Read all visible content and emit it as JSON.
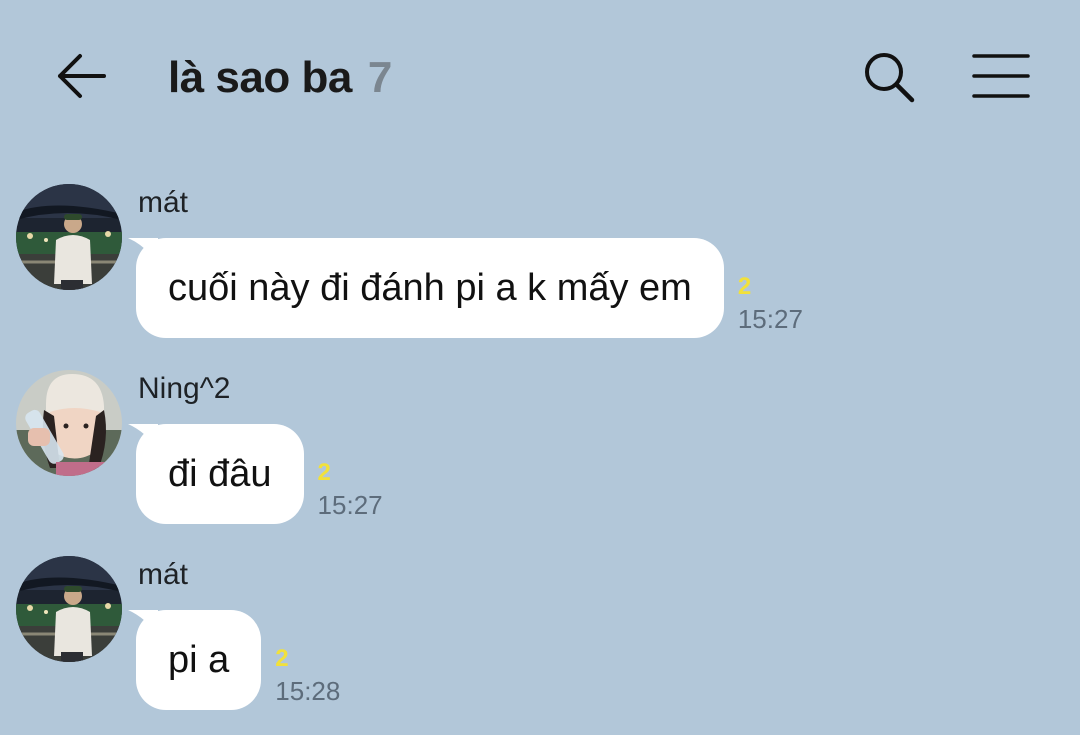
{
  "header": {
    "title": "là sao ba",
    "member_count": "7",
    "back_icon": "back-arrow-icon",
    "search_icon": "search-icon",
    "menu_icon": "hamburger-menu-icon"
  },
  "colors": {
    "background": "#b2c7d9",
    "bubble": "#ffffff",
    "unread": "#f2e13a",
    "time": "#5d6c7b"
  },
  "messages": [
    {
      "sender": "mát",
      "text": "cuối này đi đánh pi a k mấy em",
      "unread": "2",
      "time": "15:27"
    },
    {
      "sender": "Ning^2",
      "text": "đi đâu",
      "unread": "2",
      "time": "15:27"
    },
    {
      "sender": "mát",
      "text": "pi a",
      "unread": "2",
      "time": "15:28"
    }
  ]
}
